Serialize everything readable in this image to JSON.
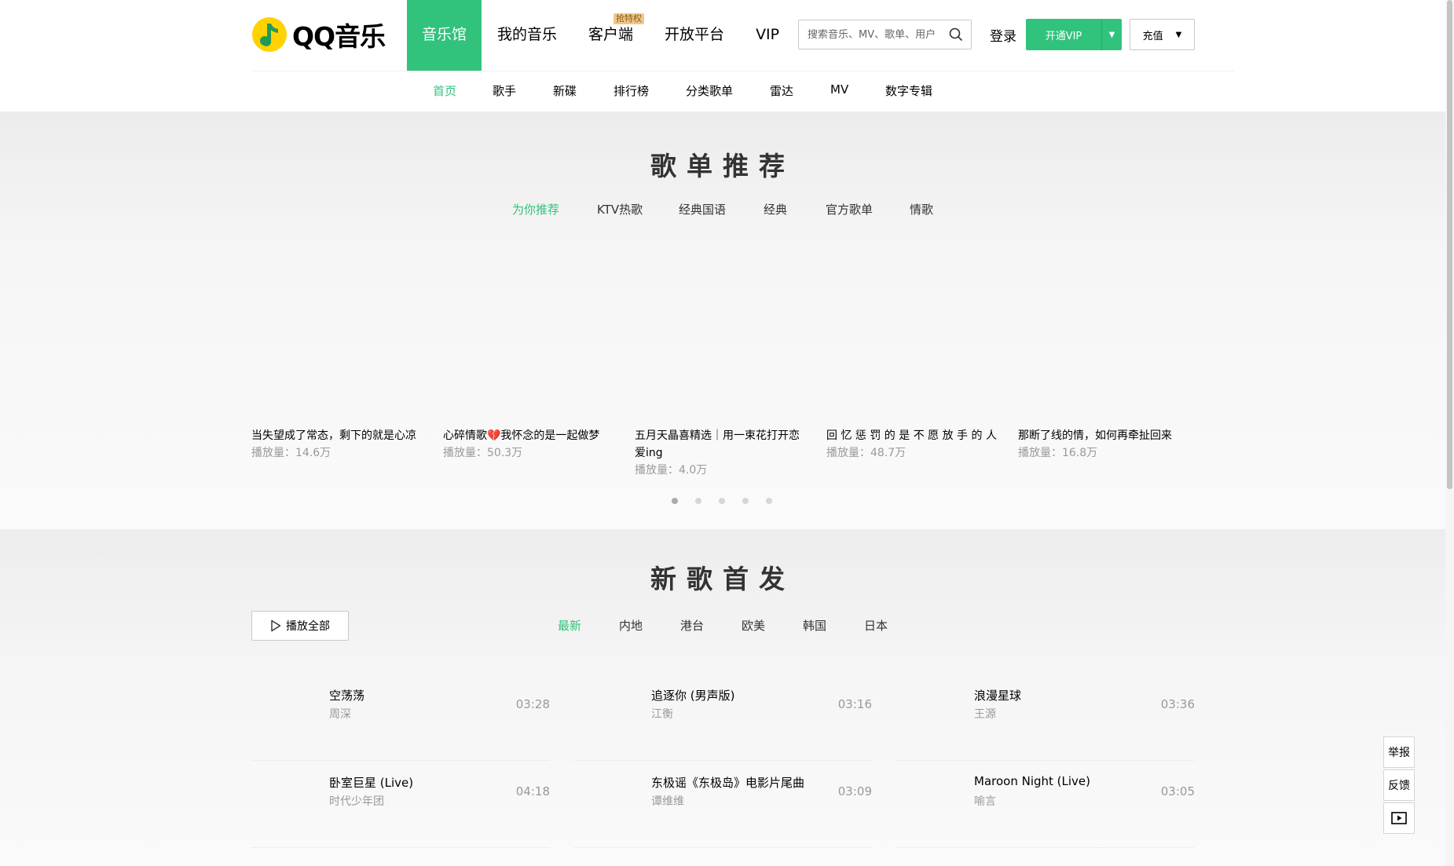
{
  "header": {
    "logo_text": "QQ音乐",
    "main_nav": [
      {
        "label": "音乐馆"
      },
      {
        "label": "我的音乐"
      },
      {
        "label": "客户端",
        "badge": "抢特权"
      },
      {
        "label": "开放平台"
      },
      {
        "label": "VIP"
      }
    ],
    "search_placeholder": "搜索音乐、MV、歌单、用户",
    "login_label": "登录",
    "vip_button_label": "开通VIP",
    "recharge_label": "充值"
  },
  "sub_nav": [
    {
      "label": "首页"
    },
    {
      "label": "歌手"
    },
    {
      "label": "新碟"
    },
    {
      "label": "排行榜"
    },
    {
      "label": "分类歌单"
    },
    {
      "label": "雷达"
    },
    {
      "label": "MV"
    },
    {
      "label": "数字专辑"
    }
  ],
  "playlist_section": {
    "title": "歌单推荐",
    "tabs": [
      {
        "label": "为你推荐"
      },
      {
        "label": "KTV热歌"
      },
      {
        "label": "经典国语"
      },
      {
        "label": "经典"
      },
      {
        "label": "官方歌单"
      },
      {
        "label": "情歌"
      }
    ],
    "cards": [
      {
        "title": "当失望成了常态，剩下的就是心凉",
        "plays": "播放量：14.6万"
      },
      {
        "title": "心碎情歌💔我怀念的是一起做梦",
        "plays": "播放量：50.3万"
      },
      {
        "title": "五月天晶喜精选｜用一束花打开恋爱ing",
        "plays": "播放量：4.0万"
      },
      {
        "title": "回 忆 惩 罚 的 是 不 愿 放 手 的 人",
        "plays": "播放量：48.7万"
      },
      {
        "title": "那断了线的情，如何再牵扯回来",
        "plays": "播放量：16.8万"
      }
    ]
  },
  "newsong_section": {
    "title": "新歌首发",
    "play_all_label": "播放全部",
    "tabs": [
      {
        "label": "最新"
      },
      {
        "label": "内地"
      },
      {
        "label": "港台"
      },
      {
        "label": "欧美"
      },
      {
        "label": "韩国"
      },
      {
        "label": "日本"
      }
    ],
    "songs": [
      {
        "title": "空荡荡",
        "artist": "周深",
        "duration": "03:28"
      },
      {
        "title": "追逐你 (男声版)",
        "artist": "江衡",
        "duration": "03:16"
      },
      {
        "title": "浪漫星球",
        "artist": "王源",
        "duration": "03:36"
      },
      {
        "title": "卧室巨星 (Live)",
        "artist": "时代少年团",
        "duration": "04:18"
      },
      {
        "title": "东极谣《东极岛》电影片尾曲",
        "artist": "谭维维",
        "duration": "03:09"
      },
      {
        "title": "Maroon Night (Live)",
        "artist": "喻言",
        "duration": "03:05"
      }
    ]
  },
  "side_tools": {
    "report": "举报",
    "feedback": "反馈"
  },
  "colors": {
    "accent": "#31c27c",
    "logo_yellow": "#ffd200"
  }
}
